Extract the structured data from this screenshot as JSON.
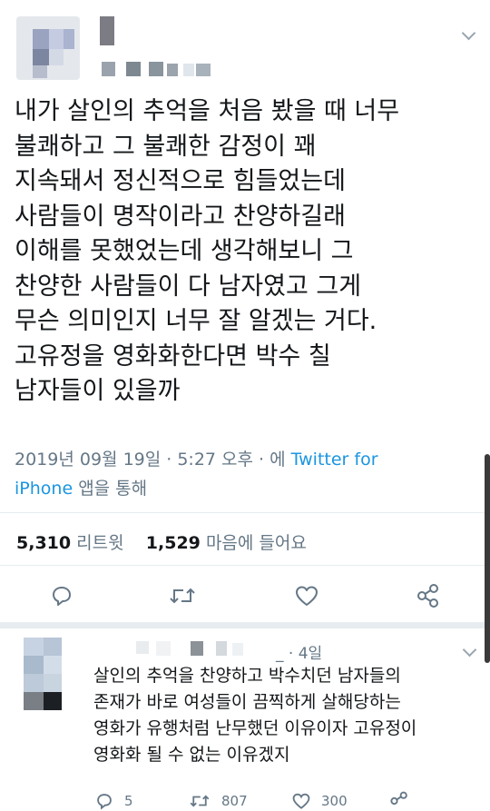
{
  "tweet": {
    "text_lines": [
      "내가 살인의 추억을 처음 봤을 때 너무",
      "불쾌하고 그 불쾌한 감정이 꽤",
      "지속돼서 정신적으로 힘들었는데",
      "사람들이 명작이라고 찬양하길래",
      "이해를 못했었는데 생각해보니 그",
      "찬양한 사람들이 다 남자였고 그게",
      "무슨 의미인지 너무 잘 알겠는 거다.",
      "고유정을 영화화한다면 박수 칠",
      "남자들이 있을까"
    ],
    "timestamp": "2019년 09월 19일 · 5:27 오후 · 에",
    "source_link": "Twitter for",
    "source_link_2": "iPhone",
    "source_suffix": "앱을 통해",
    "retweet_count": "5,310",
    "retweet_label": "리트윗",
    "like_count": "1,529",
    "like_label": "마음에 들어요"
  },
  "reply": {
    "handle_suffix": "_",
    "time": "· 4일",
    "text_lines": [
      "살인의 추억을 찬양하고 박수치던 남자들의",
      "존재가 바로 여성들이 끔찍하게 살해당하는",
      "영화가 유행처럼 난무했던 이유이자 고유정이",
      "영화화 될 수 없는 이유겠지"
    ],
    "reply_count": "5",
    "retweet_count": "807",
    "like_count": "300"
  },
  "colors": {
    "link": "#1b95e0",
    "secondary_text": "#657786",
    "icon": "#657786",
    "divider": "#e6ecf0"
  },
  "icons": [
    "reply-icon",
    "retweet-icon",
    "heart-icon",
    "share-icon",
    "chevron-down-icon"
  ]
}
